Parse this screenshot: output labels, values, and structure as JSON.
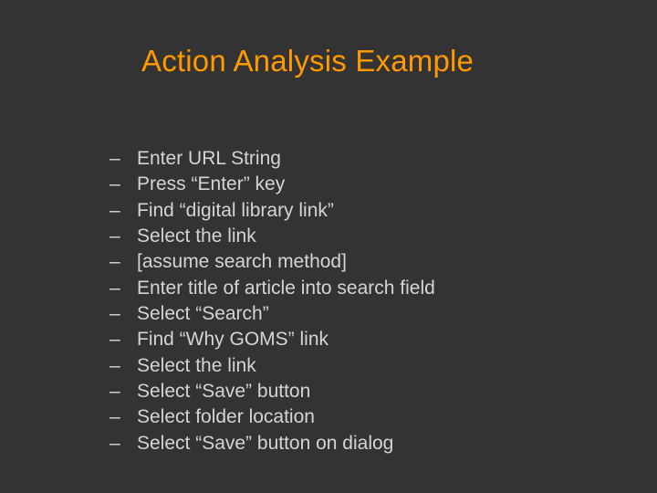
{
  "title": "Action Analysis Example",
  "bullet": "–",
  "items": [
    "Enter URL String",
    "Press “Enter” key",
    "Find “digital library link”",
    "Select the link",
    "[assume search method]",
    "Enter title of article into search field",
    "Select “Search”",
    "Find “Why GOMS” link",
    "Select the link",
    "Select “Save” button",
    "Select folder location",
    "Select “Save” button on dialog"
  ]
}
